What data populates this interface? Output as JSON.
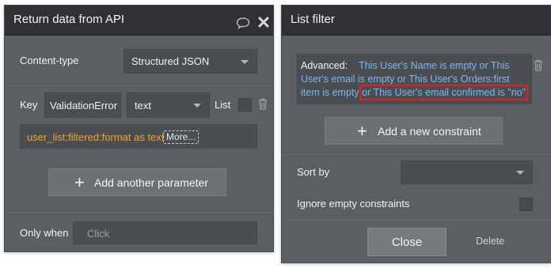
{
  "left_panel": {
    "title": "Return data from API",
    "content_type_label": "Content-type",
    "content_type_value": "Structured JSON",
    "key_label": "Key",
    "key_value": "ValidationError",
    "type_value": "text",
    "list_label": "List",
    "expression_text": "user_list:filtered:format as text",
    "more_label": "More...",
    "add_param_label": "Add another parameter",
    "only_when_label": "Only when",
    "only_when_placeholder": "Click"
  },
  "right_panel": {
    "title": "List filter",
    "advanced_label": "Advanced:",
    "advanced_line1": "This User's Name is empty or This",
    "advanced_line2": "User's email is empty or This User's Orders:first",
    "advanced_line3a": "item is empty",
    "advanced_line3b": "or This User's email confirmed is \"no\"",
    "add_constraint_label": "Add a new constraint",
    "sort_by_label": "Sort by",
    "ignore_label": "Ignore empty constraints",
    "close_label": "Close",
    "delete_label": "Delete"
  },
  "colors": {
    "panel": "#5b5e63",
    "header": "#2f3135",
    "expression_orange": "#f0a32a",
    "token_blue": "#7db6ee",
    "highlight_red": "#e02020"
  },
  "icons": [
    "comment-icon",
    "close-icon",
    "trash-icon",
    "plus-icon",
    "chevron-down-icon"
  ]
}
